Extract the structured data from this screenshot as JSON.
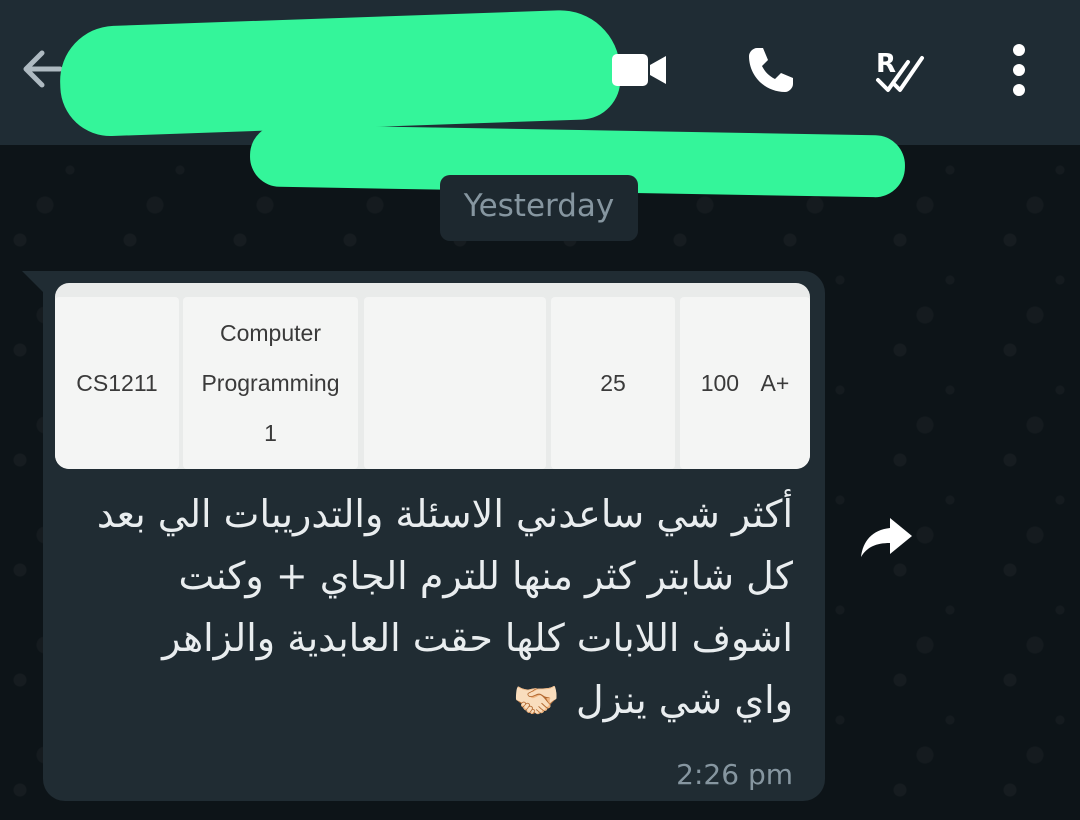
{
  "chat": {
    "date_separator": "Yesterday"
  },
  "message": {
    "table_row": {
      "code": "CS1211",
      "course_line1": "Computer",
      "course_line2": "Programming",
      "course_line3": "1",
      "blank": "",
      "value1": "25",
      "value2": "100",
      "grade": "A+"
    },
    "text": "أكثر شي ساعدني الاسئلة والتدريبات الي بعد كل شابتر كثر منها للترم الجاي + وكنت اشوف اللابات كلها حقت العابدية والزاهر واي شي ينزل",
    "emoji": "🤝🏻",
    "time": "2:26 pm"
  },
  "icons": {
    "back": "arrow-left-icon",
    "video": "video-camera-icon",
    "call": "phone-icon",
    "read_receipts": "r-double-check-icon",
    "menu": "vertical-dots-icon",
    "forward": "forward-arrow-icon"
  },
  "colors": {
    "header_bg": "#1f2c34",
    "chat_bg": "#0d1418",
    "bubble_bg": "#202c33",
    "redaction": "#34f59a",
    "text_primary": "#e9edef",
    "text_secondary": "#8696a0"
  }
}
